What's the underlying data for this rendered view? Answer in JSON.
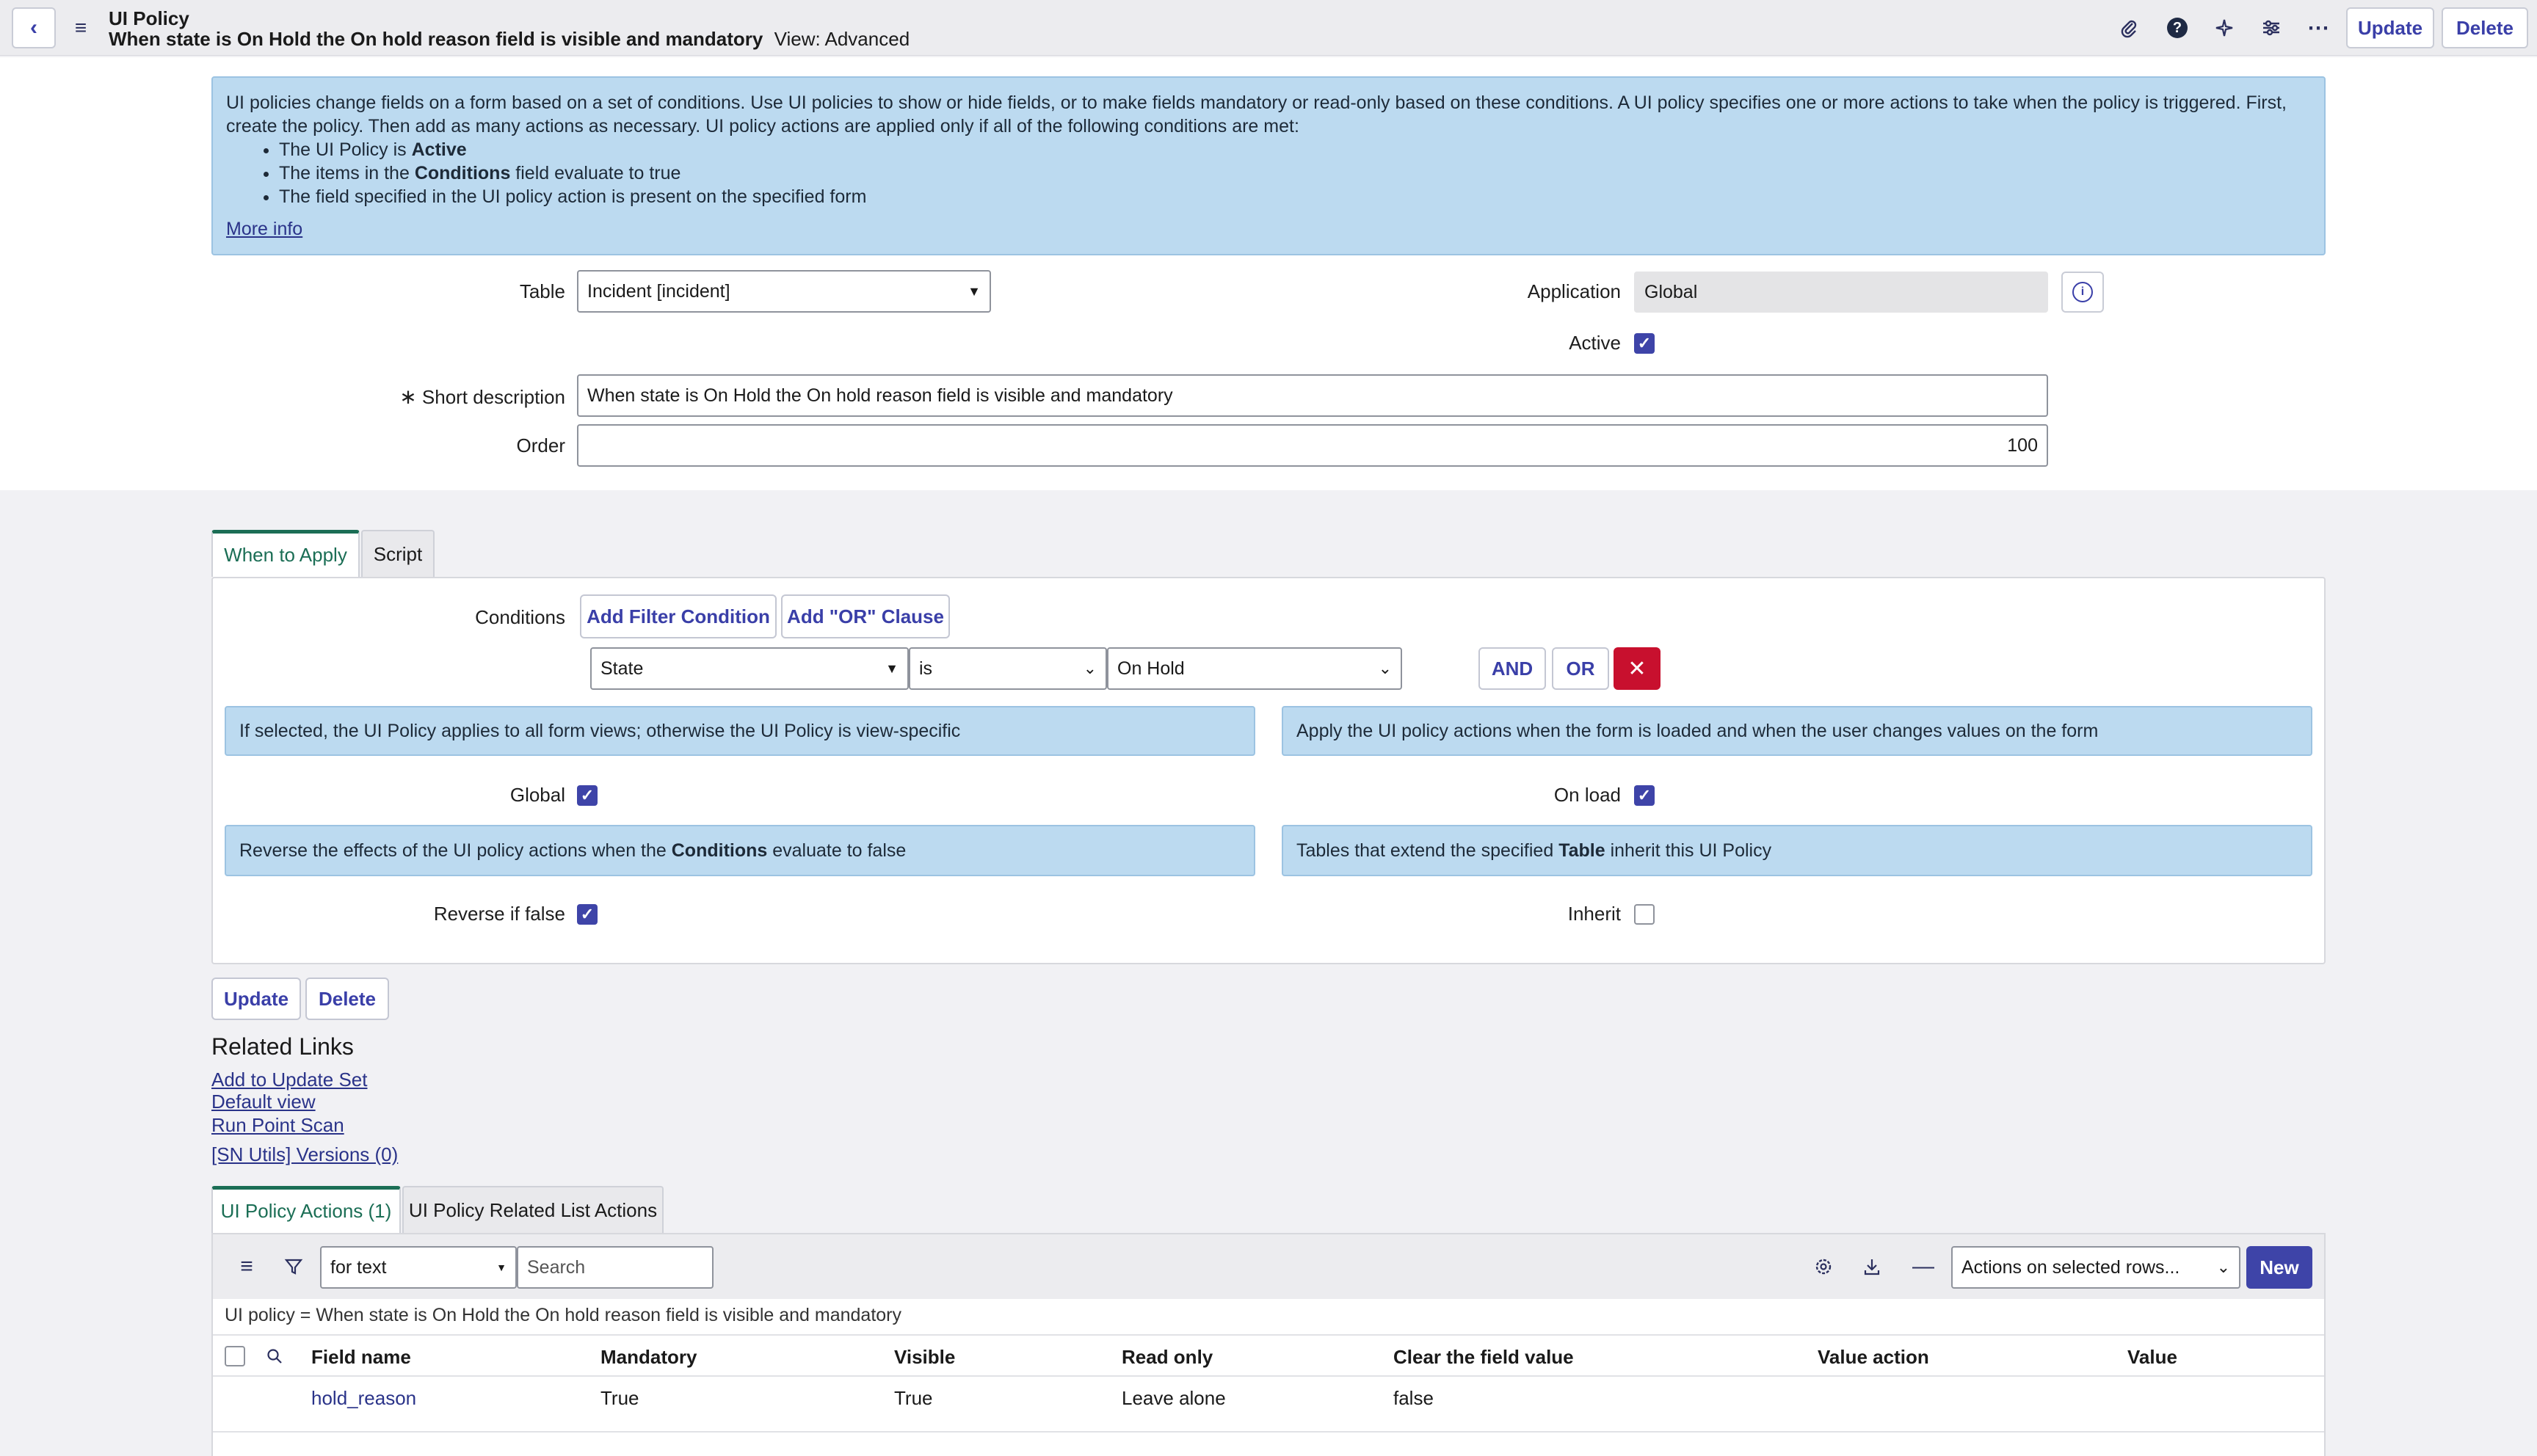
{
  "header": {
    "title": "UI Policy",
    "subtitle": "When state is On Hold the On hold reason field is visible and mandatory",
    "view": "View: Advanced",
    "update_label": "Update",
    "delete_label": "Delete"
  },
  "info_top": {
    "text": "UI policies change fields on a form based on a set of conditions. Use UI policies to show or hide fields, or to make fields mandatory or read-only based on these conditions. A UI policy specifies one or more actions to take when the policy is triggered. First, create the policy. Then add as many actions as necessary. UI policy actions are applied only if all of the following conditions are met:",
    "bullet1_pre": "The UI Policy is ",
    "bullet1_bold": "Active",
    "bullet2_pre": "The items in the ",
    "bullet2_bold": "Conditions",
    "bullet2_post": " field evaluate to true",
    "bullet3": "The field specified in the UI policy action is present on the specified form",
    "more_info": "More info"
  },
  "form": {
    "table_label": "Table",
    "table_value": "Incident [incident]",
    "application_label": "Application",
    "application_value": "Global",
    "active_label": "Active",
    "short_desc_label": "Short description",
    "short_desc_value": "When state is On Hold the On hold reason field is visible and mandatory",
    "order_label": "Order",
    "order_value": "100"
  },
  "tabs": {
    "when": "When to Apply",
    "script": "Script"
  },
  "conditions": {
    "label": "Conditions",
    "add_filter": "Add Filter Condition",
    "add_or": "Add \"OR\" Clause",
    "field": "State",
    "operator": "is",
    "value": "On Hold",
    "and_label": "AND",
    "or_label": "OR"
  },
  "options": {
    "global_info": "If selected, the UI Policy applies to all form views; otherwise the UI Policy is view-specific",
    "onload_info": "Apply the UI policy actions when the form is loaded and when the user changes values on the form",
    "global_label": "Global",
    "onload_label": "On load",
    "reverse_info_pre": "Reverse the effects of the UI policy actions when the ",
    "reverse_info_bold": "Conditions",
    "reverse_info_post": " evaluate to false",
    "inherit_info_pre": "Tables that extend the specified ",
    "inherit_info_bold": "Table",
    "inherit_info_post": " inherit this UI Policy",
    "reverse_label": "Reverse if false",
    "inherit_label": "Inherit"
  },
  "bottom_buttons": {
    "update": "Update",
    "delete": "Delete"
  },
  "related_links": {
    "title": "Related Links",
    "items": [
      "Add to Update Set",
      "Default view",
      "Run Point Scan",
      "[SN Utils] Versions (0)"
    ]
  },
  "related_tabs": {
    "actions": "UI Policy Actions (1)",
    "list_actions": "UI Policy Related List Actions"
  },
  "list": {
    "filter_select": "for text",
    "search_placeholder": "Search",
    "actions_select": "Actions on selected rows...",
    "new_label": "New",
    "breadcrumb": "UI policy = When state is On Hold the On hold reason field is visible and mandatory",
    "columns": [
      "Field name",
      "Mandatory",
      "Visible",
      "Read only",
      "Clear the field value",
      "Value action",
      "Value"
    ],
    "rows": [
      {
        "field_name": "hold_reason",
        "mandatory": "True",
        "visible": "True",
        "read_only": "Leave alone",
        "clear": "false",
        "value_action": "",
        "value": ""
      }
    ]
  },
  "colors": {
    "accent": "#3e44a8",
    "info_bg": "#bcdaf0",
    "active_tab": "#1b6e55",
    "danger": "#c8102e"
  },
  "icons": [
    "back-icon",
    "menu-icon",
    "paperclip-icon",
    "help-icon",
    "sparkle-icon",
    "settings-sliders-icon",
    "more-icon",
    "info-icon",
    "list-menu-icon",
    "filter-icon",
    "gear-icon",
    "download-icon",
    "minus-icon",
    "search-icon",
    "close-icon"
  ]
}
